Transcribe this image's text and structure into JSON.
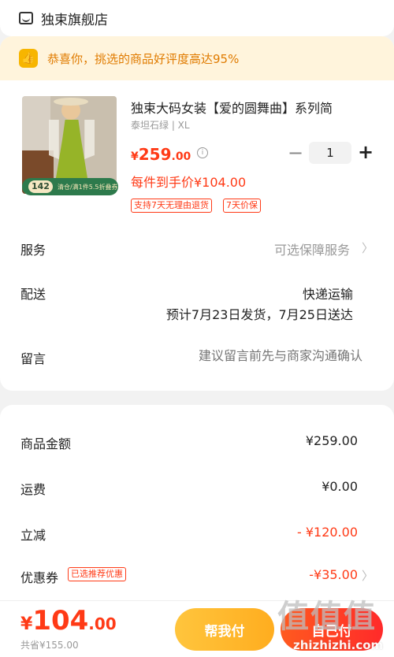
{
  "store": {
    "name": "独束旗舰店"
  },
  "banner": {
    "text": "恭喜你，挑选的商品好评度高达95%"
  },
  "product": {
    "title": "独束大码女装【爱的圆舞曲】系列简",
    "spec": "泰坦石绿 | XL",
    "price_symbol": "¥",
    "price_int": "259",
    "price_dec": ".00",
    "per_item_price": "每件到手价¥104.00",
    "quantity": "1",
    "badge_number": "142",
    "badge_text": "清仓/满1件5.5折叠券",
    "tags": [
      "支持7天无理由退货",
      "7天价保"
    ]
  },
  "rows": {
    "service_label": "服务",
    "service_value": "可选保障服务",
    "delivery_label": "配送",
    "delivery_method": "快递运输",
    "delivery_date": "预计7月23日发货，7月25日送达",
    "note_label": "留言",
    "note_placeholder": "建议留言前先与商家沟通确认"
  },
  "summary": {
    "goods_label": "商品金额",
    "goods_value": "¥259.00",
    "shipping_label": "运费",
    "shipping_value": "¥0.00",
    "discount_label": "立减",
    "discount_value": "- ¥120.00",
    "coupon_label": "优惠券",
    "coupon_badge": "已选推荐优惠",
    "coupon_value": "-¥35.00"
  },
  "bottom": {
    "total_symbol": "¥",
    "total_int": "104",
    "total_dec": ".00",
    "saved": "共省¥155.00",
    "help_pay": "帮我付",
    "self_pay": "自己付"
  },
  "watermark": {
    "big": "值值值",
    "small": "zhizhizhi.com"
  },
  "colors": {
    "accent": "#ff3a16",
    "banner_bg": "#fff4dc",
    "banner_text": "#e07b00",
    "help_pay": "#ffb52e"
  },
  "icons": {
    "store": "shop-icon",
    "banner": "thumbs-up-icon",
    "info": "info-icon",
    "chevron": "chevron-right-icon"
  }
}
